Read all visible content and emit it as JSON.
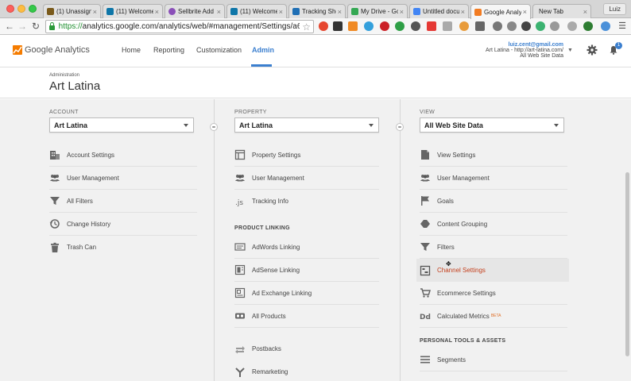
{
  "browser": {
    "tabs": [
      {
        "title": "(1) Unassigne",
        "color": "#7a5a1b"
      },
      {
        "title": "(11) Welcome",
        "color": "#0e76a8"
      },
      {
        "title": "Sellbrite Add",
        "color": "#8a4fb8"
      },
      {
        "title": "(11) Welcome",
        "color": "#0e76a8"
      },
      {
        "title": "Tracking Sho",
        "color": "#1f6fb5"
      },
      {
        "title": "My Drive - Go",
        "color": "#34a853"
      },
      {
        "title": "Untitled docu",
        "color": "#4285f4"
      },
      {
        "title": "Google Analy",
        "color": "#f27c22"
      },
      {
        "title": "New Tab",
        "color": ""
      }
    ],
    "tab_close": "×",
    "user": "Luiz",
    "url_proto": "https://",
    "url_rest": "analytics.google.com/analytics/web/#management/Settings/a61..."
  },
  "ga": {
    "logo_text": "Google Analytics",
    "nav": {
      "home": "Home",
      "reporting": "Reporting",
      "customization": "Customization",
      "admin": "Admin"
    },
    "account": {
      "email": "luiz.cent@gmail.com",
      "line1": "Art Latina - http://art-latina.com/",
      "line2": "All Web Site Data"
    },
    "notif_count": "1"
  },
  "admin": {
    "crumb": "Administration",
    "title": "Art Latina"
  },
  "account_col": {
    "header": "ACCOUNT",
    "selected": "Art Latina",
    "items": [
      "Account Settings",
      "User Management",
      "All Filters",
      "Change History",
      "Trash Can"
    ]
  },
  "property_col": {
    "header": "PROPERTY",
    "selected": "Art Latina",
    "items": [
      "Property Settings",
      "User Management",
      "Tracking Info"
    ],
    "section": "PRODUCT LINKING",
    "linking": [
      "AdWords Linking",
      "AdSense Linking",
      "Ad Exchange Linking",
      "All Products",
      "Postbacks",
      "Remarketing"
    ]
  },
  "view_col": {
    "header": "VIEW",
    "selected": "All Web Site Data",
    "items": [
      "View Settings",
      "User Management",
      "Goals",
      "Content Grouping",
      "Filters",
      "Channel Settings",
      "Ecommerce Settings",
      "Calculated Metrics"
    ],
    "beta": "BETA",
    "section": "PERSONAL TOOLS & ASSETS",
    "tools": [
      "Segments"
    ]
  }
}
